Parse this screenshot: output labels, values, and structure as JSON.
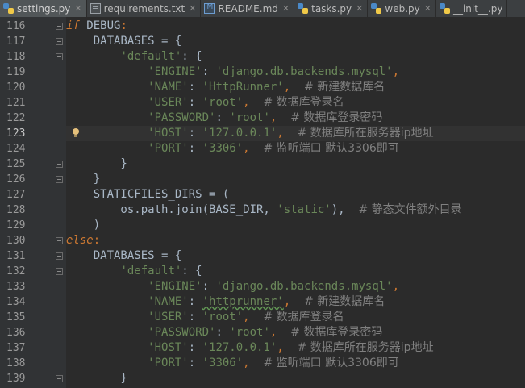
{
  "tabs": [
    {
      "label": "settings.py",
      "icon": "python-file-icon",
      "active": true
    },
    {
      "label": "requirements.txt",
      "icon": "text-file-icon",
      "active": false
    },
    {
      "label": "README.md",
      "icon": "markdown-file-icon",
      "active": false
    },
    {
      "label": "tasks.py",
      "icon": "python-file-icon",
      "active": false
    },
    {
      "label": "web.py",
      "icon": "python-file-icon",
      "active": false
    },
    {
      "label": "__init__.py",
      "icon": "python-file-icon",
      "active": false
    }
  ],
  "colors": {
    "background": "#2b2b2b",
    "gutter": "#313335",
    "keyword": "#cc7832",
    "string": "#6a8759",
    "comment": "#808080",
    "text": "#a9b7c6"
  },
  "current_line": "123",
  "editor": {
    "lines": [
      {
        "no": "116",
        "fold": "open",
        "tokens": [
          {
            "t": "if",
            "c": "kwi"
          },
          {
            "t": " DEBUG",
            "c": "pn"
          },
          {
            "t": ":",
            "c": "kw"
          }
        ]
      },
      {
        "no": "117",
        "fold": "open",
        "tokens": [
          {
            "t": "    DATABASES = {",
            "c": "pn"
          }
        ]
      },
      {
        "no": "118",
        "fold": "open",
        "tokens": [
          {
            "t": "        ",
            "c": "pn"
          },
          {
            "t": "'default'",
            "c": "str"
          },
          {
            "t": ": {",
            "c": "pn"
          }
        ]
      },
      {
        "no": "119",
        "fold": "",
        "tokens": [
          {
            "t": "            ",
            "c": "pn"
          },
          {
            "t": "'ENGINE'",
            "c": "str"
          },
          {
            "t": ": ",
            "c": "pn"
          },
          {
            "t": "'django.db.backends.mysql'",
            "c": "str"
          },
          {
            "t": ",",
            "c": "kw"
          }
        ]
      },
      {
        "no": "120",
        "fold": "",
        "tokens": [
          {
            "t": "            ",
            "c": "pn"
          },
          {
            "t": "'NAME'",
            "c": "str"
          },
          {
            "t": ": ",
            "c": "pn"
          },
          {
            "t": "'HttpRunner'",
            "c": "str"
          },
          {
            "t": ",  ",
            "c": "kw"
          },
          {
            "t": "# 新建数据库名",
            "c": "cm"
          }
        ]
      },
      {
        "no": "121",
        "fold": "",
        "tokens": [
          {
            "t": "            ",
            "c": "pn"
          },
          {
            "t": "'USER'",
            "c": "str"
          },
          {
            "t": ": ",
            "c": "pn"
          },
          {
            "t": "'root'",
            "c": "str"
          },
          {
            "t": ",  ",
            "c": "kw"
          },
          {
            "t": "# 数据库登录名",
            "c": "cm"
          }
        ]
      },
      {
        "no": "122",
        "fold": "",
        "tokens": [
          {
            "t": "            ",
            "c": "pn"
          },
          {
            "t": "'PASSWORD'",
            "c": "str"
          },
          {
            "t": ": ",
            "c": "pn"
          },
          {
            "t": "'root'",
            "c": "str"
          },
          {
            "t": ",  ",
            "c": "kw"
          },
          {
            "t": "# 数据库登录密码",
            "c": "cm"
          }
        ]
      },
      {
        "no": "123",
        "fold": "",
        "current": true,
        "bulb": true,
        "tokens": [
          {
            "t": "            ",
            "c": "pn"
          },
          {
            "t": "'HOST'",
            "c": "str"
          },
          {
            "t": ": ",
            "c": "pn"
          },
          {
            "t": "'127.0.0.1'",
            "c": "str"
          },
          {
            "t": ",  ",
            "c": "kw"
          },
          {
            "t": "# 数据库所在服务器ip地址",
            "c": "cm"
          }
        ]
      },
      {
        "no": "124",
        "fold": "",
        "tokens": [
          {
            "t": "            ",
            "c": "pn"
          },
          {
            "t": "'PORT'",
            "c": "str"
          },
          {
            "t": ": ",
            "c": "pn"
          },
          {
            "t": "'3306'",
            "c": "str"
          },
          {
            "t": ",  ",
            "c": "kw"
          },
          {
            "t": "# 监听端口 默认3306即可",
            "c": "cm"
          }
        ]
      },
      {
        "no": "125",
        "fold": "close",
        "tokens": [
          {
            "t": "        }",
            "c": "pn"
          }
        ]
      },
      {
        "no": "126",
        "fold": "close",
        "tokens": [
          {
            "t": "    }",
            "c": "pn"
          }
        ]
      },
      {
        "no": "127",
        "fold": "",
        "tokens": [
          {
            "t": "    STATICFILES_DIRS = (",
            "c": "pn"
          }
        ]
      },
      {
        "no": "128",
        "fold": "",
        "tokens": [
          {
            "t": "        os.path.join(BASE_DIR, ",
            "c": "pn"
          },
          {
            "t": "'static'",
            "c": "str"
          },
          {
            "t": "),  ",
            "c": "pn"
          },
          {
            "t": "# 静态文件额外目录",
            "c": "cm"
          }
        ]
      },
      {
        "no": "129",
        "fold": "",
        "tokens": [
          {
            "t": "    )",
            "c": "pn"
          }
        ]
      },
      {
        "no": "130",
        "fold": "open",
        "tokens": [
          {
            "t": "else",
            "c": "kwi"
          },
          {
            "t": ":",
            "c": "kw"
          }
        ]
      },
      {
        "no": "131",
        "fold": "open",
        "tokens": [
          {
            "t": "    DATABASES = {",
            "c": "pn"
          }
        ]
      },
      {
        "no": "132",
        "fold": "open",
        "tokens": [
          {
            "t": "        ",
            "c": "pn"
          },
          {
            "t": "'default'",
            "c": "str"
          },
          {
            "t": ": {",
            "c": "pn"
          }
        ]
      },
      {
        "no": "133",
        "fold": "",
        "tokens": [
          {
            "t": "            ",
            "c": "pn"
          },
          {
            "t": "'ENGINE'",
            "c": "str"
          },
          {
            "t": ": ",
            "c": "pn"
          },
          {
            "t": "'django.db.backends.mysql'",
            "c": "str"
          },
          {
            "t": ",",
            "c": "kw"
          }
        ]
      },
      {
        "no": "134",
        "fold": "",
        "tokens": [
          {
            "t": "            ",
            "c": "pn"
          },
          {
            "t": "'NAME'",
            "c": "str"
          },
          {
            "t": ": ",
            "c": "pn"
          },
          {
            "t": "'httprunner'",
            "c": "str ul"
          },
          {
            "t": ",  ",
            "c": "kw"
          },
          {
            "t": "# 新建数据库名",
            "c": "cm"
          }
        ]
      },
      {
        "no": "135",
        "fold": "",
        "tokens": [
          {
            "t": "            ",
            "c": "pn"
          },
          {
            "t": "'USER'",
            "c": "str"
          },
          {
            "t": ": ",
            "c": "pn"
          },
          {
            "t": "'root'",
            "c": "str"
          },
          {
            "t": ",  ",
            "c": "kw"
          },
          {
            "t": "# 数据库登录名",
            "c": "cm"
          }
        ]
      },
      {
        "no": "136",
        "fold": "",
        "tokens": [
          {
            "t": "            ",
            "c": "pn"
          },
          {
            "t": "'PASSWORD'",
            "c": "str"
          },
          {
            "t": ": ",
            "c": "pn"
          },
          {
            "t": "'root'",
            "c": "str"
          },
          {
            "t": ",  ",
            "c": "kw"
          },
          {
            "t": "# 数据库登录密码",
            "c": "cm"
          }
        ]
      },
      {
        "no": "137",
        "fold": "",
        "tokens": [
          {
            "t": "            ",
            "c": "pn"
          },
          {
            "t": "'HOST'",
            "c": "str"
          },
          {
            "t": ": ",
            "c": "pn"
          },
          {
            "t": "'127.0.0.1'",
            "c": "str"
          },
          {
            "t": ",  ",
            "c": "kw"
          },
          {
            "t": "# 数据库所在服务器ip地址",
            "c": "cm"
          }
        ]
      },
      {
        "no": "138",
        "fold": "",
        "tokens": [
          {
            "t": "            ",
            "c": "pn"
          },
          {
            "t": "'PORT'",
            "c": "str"
          },
          {
            "t": ": ",
            "c": "pn"
          },
          {
            "t": "'3306'",
            "c": "str"
          },
          {
            "t": ",  ",
            "c": "kw"
          },
          {
            "t": "# 监听端口 默认3306即可",
            "c": "cm"
          }
        ]
      },
      {
        "no": "139",
        "fold": "close",
        "tokens": [
          {
            "t": "        }",
            "c": "pn"
          }
        ]
      }
    ]
  }
}
